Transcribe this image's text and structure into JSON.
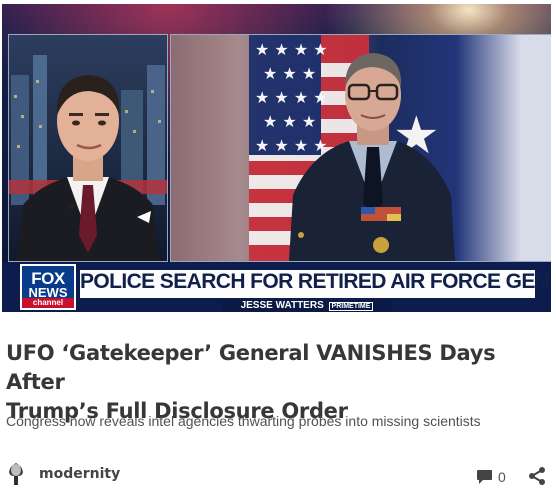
{
  "video": {
    "logo_top": "FOX",
    "logo_middle": "NEWS",
    "logo_bottom": "channel",
    "headline": "POLICE SEARCH FOR RETIRED AIR FORCE GENERAL",
    "show_name": "JESSE WATTERS",
    "show_tag": "PRIMETIME"
  },
  "article": {
    "title_line1": "UFO ‘Gatekeeper’ General VANISHES Days After",
    "title_line2": "Trump’s Full Disclosure Order",
    "subtitle": "Congress now reveals intel agencies thwarting probes into missing scientists"
  },
  "footer": {
    "author": "modernity",
    "comment_count": "0",
    "comment_icon": "comment-icon",
    "share_icon": "share-icon"
  },
  "colors": {
    "title": "#363737",
    "subtitle": "#515151",
    "fox_blue": "#0a3a8a",
    "fox_red": "#c8102e",
    "lower_third": "#0c1d4d"
  }
}
